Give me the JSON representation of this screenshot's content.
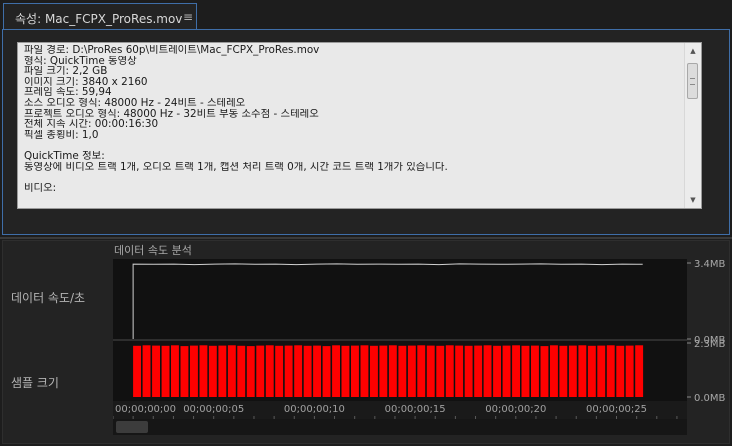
{
  "tab": {
    "title": "속성: Mac_FCPX_ProRes.mov",
    "menu_icon": "hamburger-icon"
  },
  "info": {
    "lines": [
      "파일 경로: D:\\ProRes 60p\\비트레이트\\Mac_FCPX_ProRes.mov",
      "형식: QuickTime 동영상",
      "파일 크기: 2,2 GB",
      "이미지 크기: 3840 x 2160",
      "프레임 속도: 59,94",
      "소스 오디오 형식: 48000 Hz - 24비트 - 스테레오",
      "프로젝트 오디오 형식: 48000 Hz - 32비트 부동 소수점 - 스테레오",
      "전체 지속 시간: 00:00:16:30",
      "픽셀 종횡비: 1,0",
      "",
      "QuickTime 정보:",
      "동영상에 비디오 트랙 1개, 오디오 트랙 1개, 캡션 처리 트랙 0개, 시간 코드 트랙 1개가 있습니다.",
      "",
      "비디오:"
    ]
  },
  "analysis": {
    "title": "데이터 속도 분석",
    "row_data_rate_label": "데이터 속도/초",
    "row_sample_size_label": "샘플 크기"
  },
  "chart_data": [
    {
      "type": "line",
      "name": "데이터 속도/초",
      "y_ticks": [
        "3.4MB",
        "0.0MB"
      ],
      "ylim": [
        0,
        3.4
      ],
      "x_start_seconds": 1,
      "x_end_seconds": 26.3,
      "plateau_value": 3.35,
      "values": [
        3.35,
        3.34,
        3.35,
        3.33,
        3.35,
        3.36,
        3.34,
        3.35,
        3.33,
        3.35,
        3.36,
        3.34,
        3.35,
        3.34,
        3.35,
        3.33,
        3.36,
        3.35,
        3.34,
        3.35,
        3.36,
        3.34,
        3.35,
        3.33,
        3.35,
        3.34
      ],
      "line_color": "#d0d0d0"
    },
    {
      "type": "bar",
      "name": "샘플 크기",
      "y_ticks": [
        "2.3MB",
        "0.0MB"
      ],
      "ylim": [
        0,
        2.3
      ],
      "values": [
        2.18,
        2.2,
        2.19,
        2.18,
        2.2,
        2.17,
        2.19,
        2.2,
        2.18,
        2.19,
        2.2,
        2.18,
        2.17,
        2.19,
        2.2,
        2.18,
        2.19,
        2.2,
        2.18,
        2.19,
        2.17,
        2.2,
        2.18,
        2.19,
        2.2,
        2.18,
        2.19,
        2.2,
        2.18,
        2.19,
        2.2,
        2.19,
        2.18,
        2.2,
        2.19,
        2.18,
        2.19,
        2.2,
        2.18,
        2.19,
        2.2,
        2.18,
        2.19,
        2.17,
        2.2,
        2.18,
        2.19,
        2.2,
        2.18,
        2.19,
        2.2,
        2.18,
        2.19,
        2.2
      ],
      "bar_color": "#ff0000",
      "x_tick_labels": [
        "00;00;00;00",
        "00;00;00;05",
        "00;00;00;10",
        "00;00;00;15",
        "00;00;00;20",
        "00;00;00;25"
      ],
      "x_tick_seconds": [
        0,
        5,
        10,
        15,
        20,
        25
      ],
      "x_range_seconds": [
        0,
        28.5
      ]
    }
  ]
}
